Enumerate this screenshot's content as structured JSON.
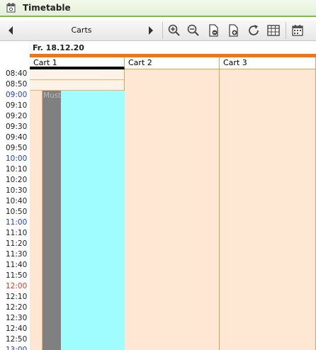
{
  "window": {
    "title": "Timetable"
  },
  "toolbar": {
    "view_label": "Carts",
    "buttons": [
      "previous-icon",
      "next-icon",
      "zoom-in-icon",
      "zoom-out-icon",
      "page-minus-icon",
      "page-plus-icon",
      "refresh-icon",
      "table-icon",
      "calendar-icon"
    ]
  },
  "calendar": {
    "date": "Fr. 18.12.20",
    "columns": [
      "Cart 1",
      "Cart 2",
      "Cart 3"
    ],
    "times": [
      "08:40",
      "08:50",
      "09:00",
      "09:10",
      "09:20",
      "09:30",
      "09:40",
      "09:50",
      "10:00",
      "10:10",
      "10:20",
      "10:30",
      "10:40",
      "10:50",
      "11:00",
      "11:10",
      "11:20",
      "11:30",
      "11:40",
      "11:50",
      "12:00",
      "12:10",
      "12:20",
      "12:30",
      "12:40",
      "12:50",
      "13:00"
    ],
    "appointment": {
      "label": "Must",
      "column": "Cart 1",
      "start": "09:00",
      "color": "#9ffcff",
      "bar_color": "#808080"
    }
  },
  "colors": {
    "accent": "#ee7a0c",
    "title_border": "#7fb843",
    "hour_label": "#1f3fe0",
    "noon_label": "#e03a1c",
    "slot_bg": "#ffe8d3"
  }
}
